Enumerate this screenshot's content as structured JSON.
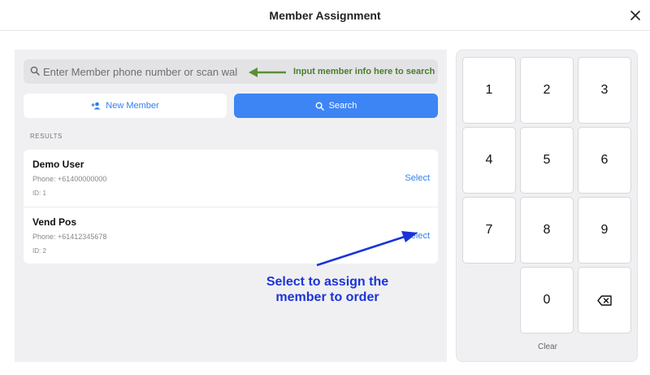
{
  "header": {
    "title": "Member Assignment"
  },
  "search": {
    "placeholder": "Enter Member phone number or scan wallet",
    "annotation": "Input member info here to search"
  },
  "actions": {
    "new_member_label": "New Member",
    "search_label": "Search"
  },
  "results": {
    "label": "RESULTS",
    "items": [
      {
        "name": "Demo User",
        "phone": "Phone: +61400000000",
        "id": "ID: 1",
        "select_label": "Select"
      },
      {
        "name": "Vend Pos",
        "phone": "Phone: +61412345678",
        "id": "ID: 2",
        "select_label": "Select"
      }
    ],
    "annotation_line1": "Select to assign the",
    "annotation_line2": "member to order"
  },
  "keypad": {
    "keys": [
      "1",
      "2",
      "3",
      "4",
      "5",
      "6",
      "7",
      "8",
      "9",
      "0"
    ],
    "clear_label": "Clear"
  },
  "colors": {
    "accent": "#3d85f5",
    "annotation_green": "#4a7d2c",
    "annotation_blue": "#1a34d8"
  },
  "icons": [
    "close-icon",
    "search-icon",
    "add-user-icon",
    "backspace-icon"
  ]
}
